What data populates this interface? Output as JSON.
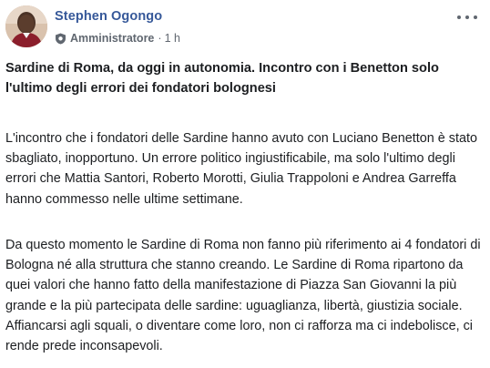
{
  "post": {
    "author": "Stephen Ogongo",
    "role": "Amministratore",
    "separator": "·",
    "time": "1 h",
    "title": "Sardine di Roma, da oggi in autonomia. Incontro con i Benetton solo l'ultimo degli errori dei fondatori bolognesi",
    "paragraphs": [
      "L'incontro che i fondatori delle Sardine hanno avuto con Luciano Benetton è stato sbagliato, inopportuno. Un errore politico ingiustificabile, ma solo l'ultimo degli errori che Mattia Santori, Roberto Morotti, Giulia Trappoloni e Andrea Garreffa hanno commesso nelle ultime settimane.",
      "Da questo momento le Sardine di Roma non fanno più riferimento ai 4 fondatori di Bologna né alla struttura che stanno creando. Le Sardine di Roma ripartono da quei valori che hanno fatto della manifestazione di Piazza San Giovanni la più grande e la più partecipata delle sardine: uguaglianza, libertà, giustizia sociale. Affiancarsi agli squali, o diventare come loro, non ci rafforza ma ci indebolisce, ci rende prede inconsapevoli."
    ]
  },
  "icons": {
    "role_badge": "admin-shield-icon",
    "more": "more-options-icon"
  },
  "colors": {
    "author": "#365899",
    "meta": "#616770",
    "text": "#1c1e21"
  }
}
